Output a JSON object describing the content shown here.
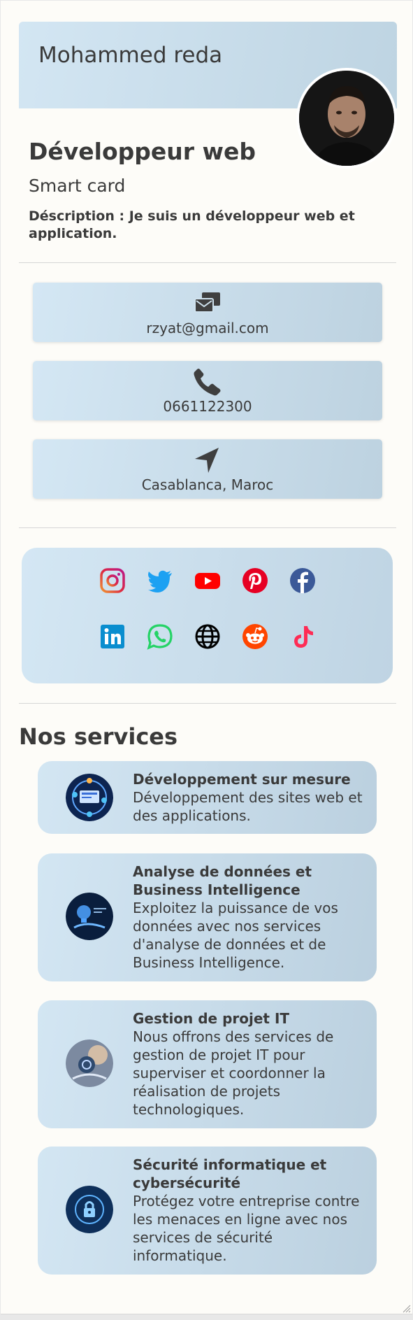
{
  "profile": {
    "name": "Mohammed reda",
    "title": "Développeur web",
    "subtitle": "Smart card",
    "description": "Déscription : Je suis un développeur web et application."
  },
  "contacts": [
    {
      "icon": "envelopes-icon",
      "text": "rzyat@gmail.com"
    },
    {
      "icon": "phone-icon",
      "text": "0661122300"
    },
    {
      "icon": "location-arrow-icon",
      "text": "Casablanca, Maroc"
    }
  ],
  "social": [
    {
      "icon": "instagram-icon",
      "color": "#c13584"
    },
    {
      "icon": "twitter-icon",
      "color": "#1da1f2"
    },
    {
      "icon": "youtube-icon",
      "color": "#ff0000"
    },
    {
      "icon": "pinterest-icon",
      "color": "#e60023"
    },
    {
      "icon": "facebook-icon",
      "color": "#3b5998"
    },
    {
      "icon": "linkedin-icon",
      "color": "#0a8ecf"
    },
    {
      "icon": "whatsapp-icon",
      "color": "#25d366"
    },
    {
      "icon": "globe-icon",
      "color": "#000000"
    },
    {
      "icon": "reddit-icon",
      "color": "#ff4500"
    },
    {
      "icon": "tiktok-icon",
      "color": "#fe2c55"
    }
  ],
  "services_title": "Nos services",
  "services": [
    {
      "name": "Développement sur mesure",
      "description": "Développement des sites web et des applications."
    },
    {
      "name": "Analyse de données et Business Intelligence",
      "description": "Exploitez la puissance de vos données avec nos services d'analyse de données et de Business Intelligence."
    },
    {
      "name": "Gestion de projet IT",
      "description": "Nous offrons des services de gestion de projet IT pour superviser et coordonner la réalisation de projets technologiques."
    },
    {
      "name": "Sécurité informatique et cybersécurité",
      "description": "Protégez votre entreprise contre les menaces en ligne avec nos services de sécurité informatique."
    }
  ],
  "colors": {
    "accent_gradient_start": "#d3e6f3",
    "accent_gradient_end": "#bdd2e0",
    "text": "#3a3a3a",
    "background": "#fdfcf8"
  }
}
